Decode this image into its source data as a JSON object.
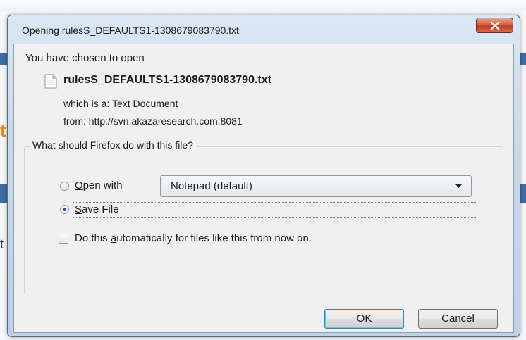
{
  "dialog": {
    "title": "Opening rulesS_DEFAULTS1-1308679083790.txt",
    "close_icon": "close-x-icon",
    "intro": "You have chosen to open",
    "file_icon": "text-file-icon",
    "filename": "rulesS_DEFAULTS1-1308679083790.txt",
    "which_is": "which is a:  Text Document",
    "from": "from:  http://svn.akazaresearch.com:8081",
    "group_legend": "What should Firefox do with this file?",
    "options": {
      "open_with_pre": "",
      "open_with_key": "O",
      "open_with_post": "pen with",
      "open_with_app": "Notepad (default)",
      "save_file_key": "S",
      "save_file_post": "ave File",
      "selected": "save_file",
      "auto_pre": "Do this ",
      "auto_key": "a",
      "auto_post": "utomatically for files like this from now on.",
      "auto_checked": false
    },
    "buttons": {
      "ok": "OK",
      "cancel": "Cancel"
    }
  },
  "colors": {
    "close_button": "#c23a1f",
    "window_frame": "#c9d9ea",
    "client_bg": "#f0f0f0",
    "background_bar": "#3c6ea4"
  }
}
